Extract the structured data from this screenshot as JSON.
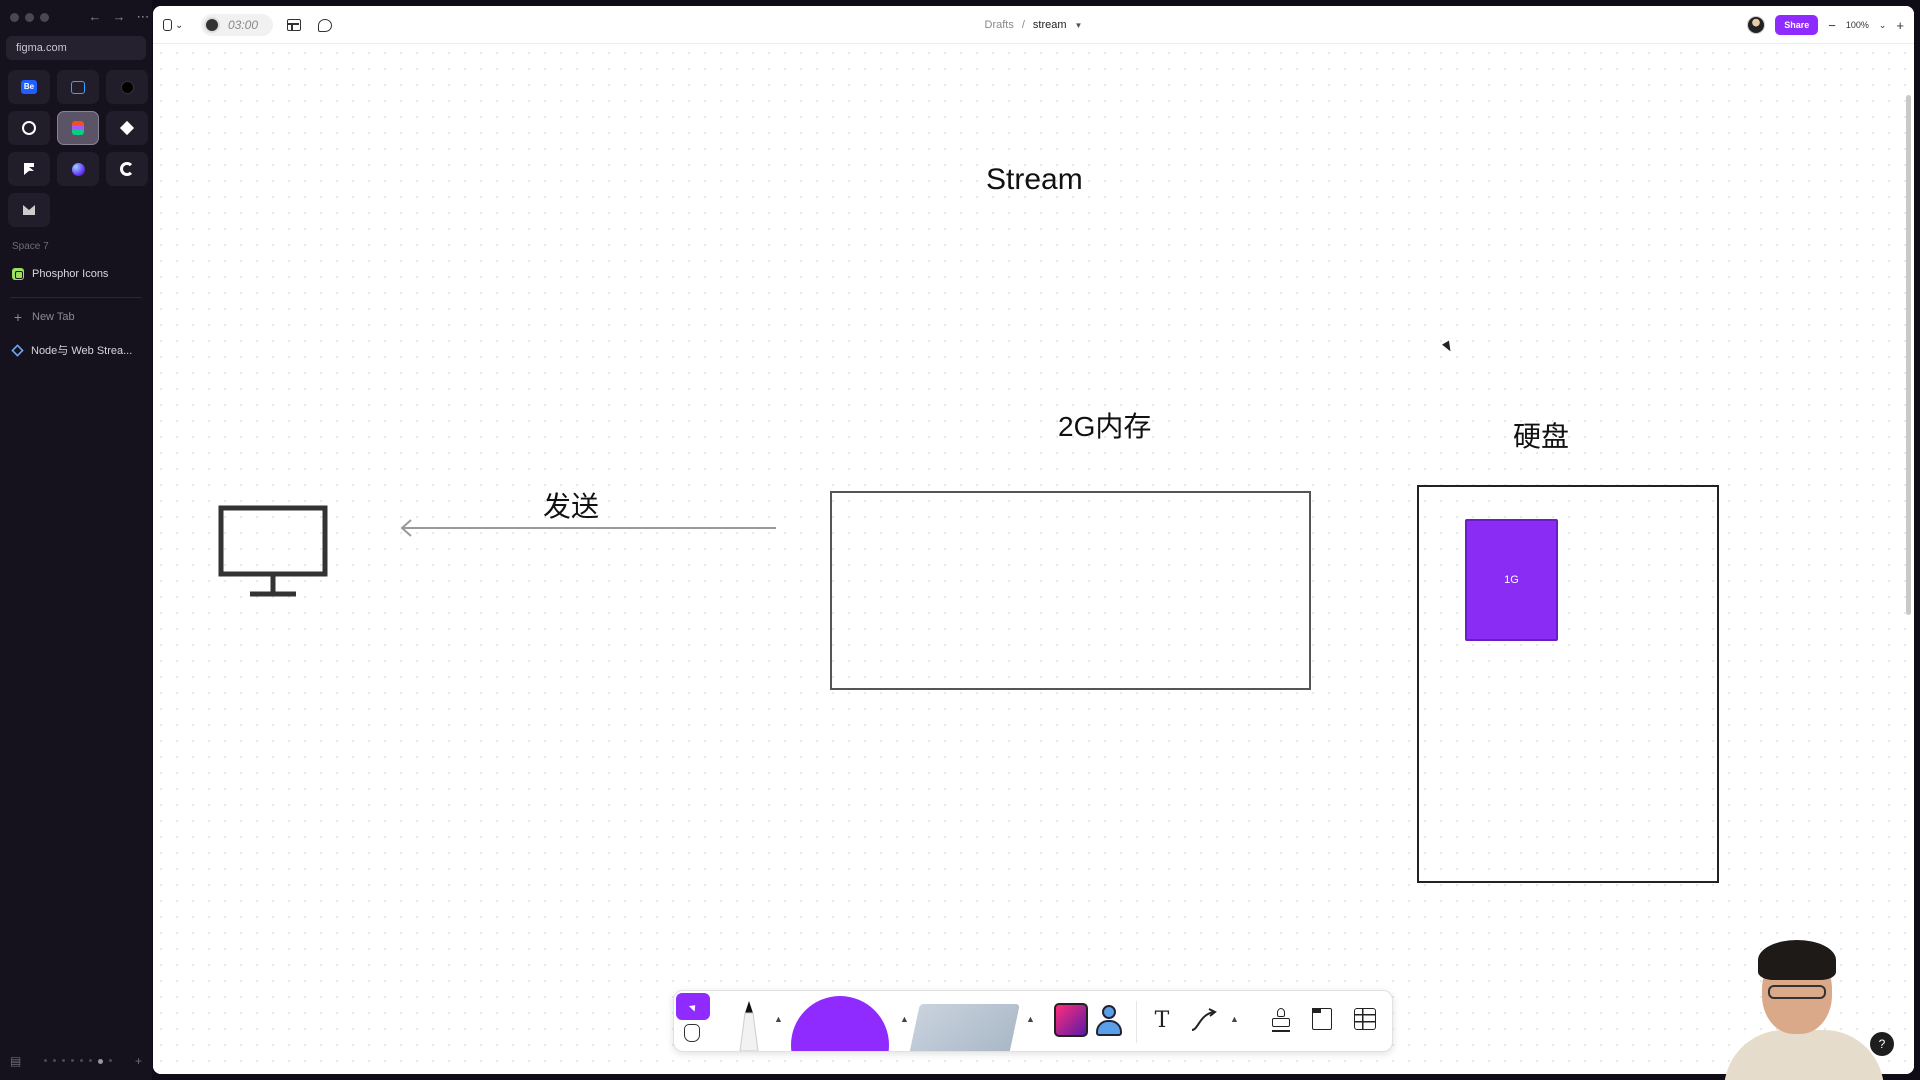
{
  "browser": {
    "url": "figma.com",
    "space_label": "Space 7",
    "pinned": [
      "Phosphor Icons"
    ],
    "new_tab_label": "New Tab",
    "tabs": [
      "Node与 Web Strea..."
    ]
  },
  "figma": {
    "timer": "03:00",
    "breadcrumb": {
      "folder": "Drafts",
      "separator": "/",
      "file": "stream"
    },
    "share_label": "Share",
    "zoom": "100%",
    "zoom_out": "−",
    "zoom_in": "+"
  },
  "canvas": {
    "title": "Stream",
    "memory_label": "2G内存",
    "disk_label": "硬盘",
    "send_label": "发送",
    "chunk_label": "1G"
  },
  "dock": {
    "text_tool_glyph": "T"
  },
  "help_label": "?",
  "colors": {
    "accent": "#8f2bff",
    "chunk": "#8b2cf5"
  }
}
